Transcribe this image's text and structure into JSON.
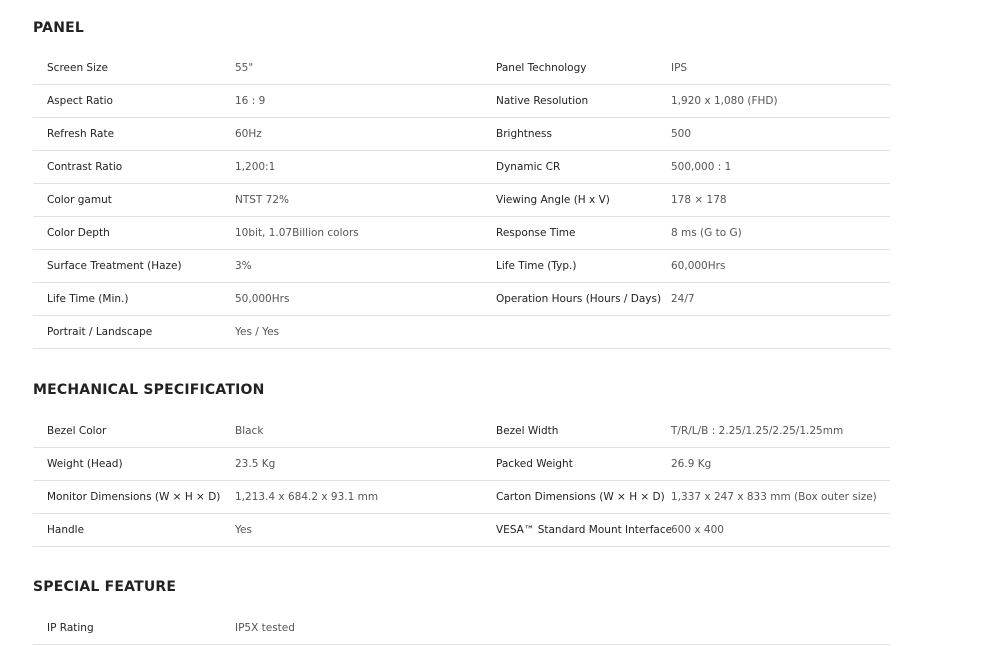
{
  "panel": {
    "title": "PANEL",
    "rows": [
      [
        "Screen Size",
        "55\"",
        "Panel Technology",
        "IPS"
      ],
      [
        "Aspect Ratio",
        "16 : 9",
        "Native Resolution",
        "1,920 x 1,080 (FHD)"
      ],
      [
        "Refresh Rate",
        "60Hz",
        "Brightness",
        "500"
      ],
      [
        "Contrast Ratio",
        "1,200:1",
        "Dynamic CR",
        "500,000 : 1"
      ],
      [
        "Color gamut",
        "NTST 72%",
        "Viewing Angle (H x V)",
        "178 × 178"
      ],
      [
        "Color Depth",
        "10bit, 1.07Billion colors",
        "Response Time",
        "8 ms (G to G)"
      ],
      [
        "Surface Treatment (Haze)",
        "3%",
        "Life Time (Typ.)",
        "60,000Hrs"
      ],
      [
        "Life Time (Min.)",
        "50,000Hrs",
        "Operation Hours (Hours / Days)",
        "24/7"
      ],
      [
        "Portrait / Landscape",
        "Yes / Yes",
        "",
        ""
      ]
    ]
  },
  "mechanical": {
    "title": "MECHANICAL SPECIFICATION",
    "rows": [
      [
        "Bezel Color",
        "Black",
        "Bezel Width",
        "T/R/L/B : 2.25/1.25/2.25/1.25mm"
      ],
      [
        "Weight (Head)",
        "23.5 Kg",
        "Packed Weight",
        "26.9 Kg"
      ],
      [
        "Monitor Dimensions (W × H × D)",
        "1,213.4 x 684.2 x 93.1 mm",
        "Carton Dimensions (W × H × D)",
        "1,337 x 247 x 833 mm (Box outer size)"
      ],
      [
        "Handle",
        "Yes",
        "VESA™ Standard Mount Interface",
        "600 x 400"
      ]
    ]
  },
  "special": {
    "title": "SPECIAL FEATURE",
    "rows": [
      [
        "IP Rating",
        "IP5X tested",
        "",
        ""
      ]
    ]
  }
}
